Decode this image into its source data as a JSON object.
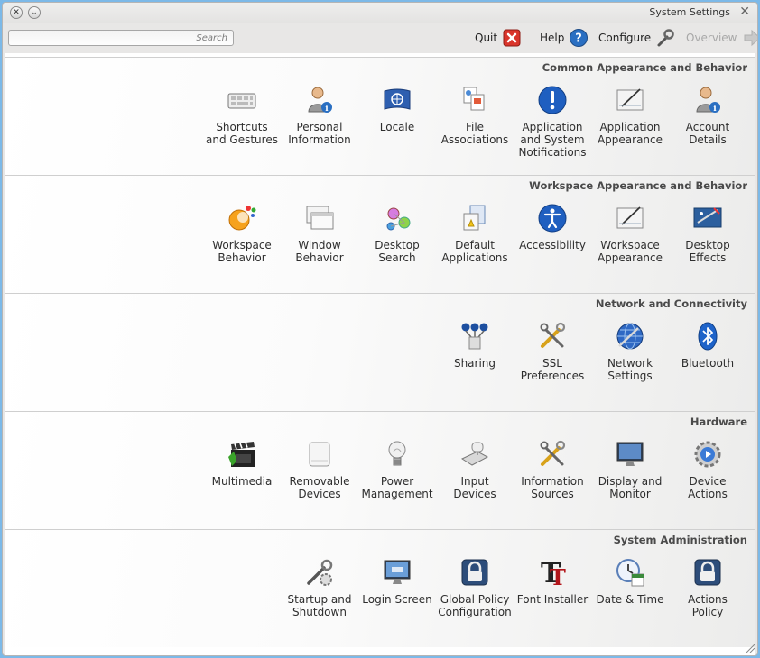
{
  "window": {
    "title": "System Settings"
  },
  "toolbar": {
    "search_placeholder": "Search",
    "quit_label": "Quit",
    "help_label": "Help",
    "configure_label": "Configure",
    "overview_label": "Overview"
  },
  "categories": [
    {
      "title": "Common Appearance and Behavior",
      "modules": [
        {
          "label": "Shortcuts\nand Gestures",
          "icon": "keyboard-icon"
        },
        {
          "label": "Personal\nInformation",
          "icon": "person-info-icon"
        },
        {
          "label": "Locale",
          "icon": "un-flag-icon"
        },
        {
          "label": "File\nAssociations",
          "icon": "file-types-icon"
        },
        {
          "label": "Application\nand System\nNotifications",
          "icon": "notification-icon"
        },
        {
          "label": "Application\nAppearance",
          "icon": "appearance-icon"
        },
        {
          "label": "Account\nDetails",
          "icon": "account-icon"
        }
      ]
    },
    {
      "title": "Workspace Appearance and Behavior",
      "modules": [
        {
          "label": "Workspace\nBehavior",
          "icon": "workspace-icon"
        },
        {
          "label": "Window\nBehavior",
          "icon": "window-icon"
        },
        {
          "label": "Desktop\nSearch",
          "icon": "desktop-search-icon"
        },
        {
          "label": "Default\nApplications",
          "icon": "default-apps-icon"
        },
        {
          "label": "Accessibility",
          "icon": "accessibility-icon"
        },
        {
          "label": "Workspace\nAppearance",
          "icon": "appearance-icon"
        },
        {
          "label": "Desktop\nEffects",
          "icon": "desktop-effects-icon"
        }
      ]
    },
    {
      "title": "Network and Connectivity",
      "modules": [
        {
          "label": "Sharing",
          "icon": "sharing-icon"
        },
        {
          "label": "SSL\nPreferences",
          "icon": "tools-icon"
        },
        {
          "label": "Network\nSettings",
          "icon": "network-globe-icon"
        },
        {
          "label": "Bluetooth",
          "icon": "bluetooth-icon"
        }
      ]
    },
    {
      "title": "Hardware",
      "modules": [
        {
          "label": "Multimedia",
          "icon": "clapperboard-icon"
        },
        {
          "label": "Removable\nDevices",
          "icon": "drive-icon"
        },
        {
          "label": "Power\nManagement",
          "icon": "lightbulb-icon"
        },
        {
          "label": "Input\nDevices",
          "icon": "input-devices-icon"
        },
        {
          "label": "Information\nSources",
          "icon": "tools-icon"
        },
        {
          "label": "Display and\nMonitor",
          "icon": "monitor-icon"
        },
        {
          "label": "Device\nActions",
          "icon": "device-actions-icon"
        }
      ]
    },
    {
      "title": "System Administration",
      "modules": [
        {
          "label": "Startup and\nShutdown",
          "icon": "startup-icon"
        },
        {
          "label": "Login Screen",
          "icon": "login-screen-icon"
        },
        {
          "label": "Global Policy\nConfiguration",
          "icon": "policy-lock-icon"
        },
        {
          "label": "Font Installer",
          "icon": "font-icon"
        },
        {
          "label": "Date & Time",
          "icon": "clock-icon"
        },
        {
          "label": "Actions\nPolicy",
          "icon": "policy-lock-icon"
        }
      ]
    }
  ]
}
